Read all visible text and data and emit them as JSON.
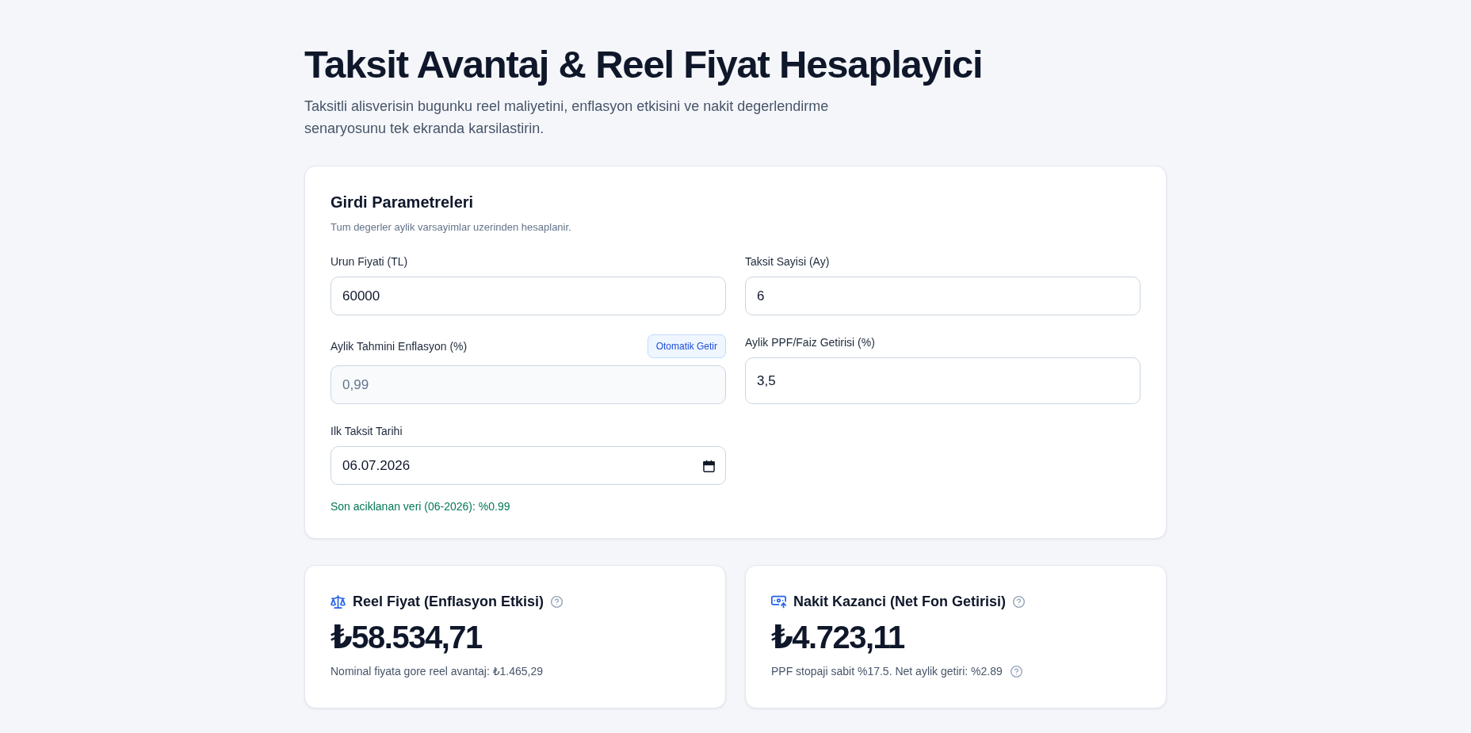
{
  "header": {
    "title": "Taksit Avantaj & Reel Fiyat Hesaplayici",
    "subtitle": "Taksitli alisverisin bugunku reel maliyetini, enflasyon etkisini ve nakit degerlendirme senaryosunu tek ekranda karsilastirin."
  },
  "form": {
    "title": "Girdi Parametreleri",
    "hint": "Tum degerler aylik varsayimlar uzerinden hesaplanir.",
    "fields": [
      {
        "label": "Urun Fiyati (TL)",
        "value": "60000",
        "kind": "text",
        "disabled": false
      },
      {
        "label": "Taksit Sayisi (Ay)",
        "value": "6",
        "kind": "text",
        "disabled": false
      },
      {
        "label": "Aylik Tahmini Enflasyon (%)",
        "value": "0,99",
        "kind": "text",
        "disabled": true,
        "button": "Otomatik Getir"
      },
      {
        "label": "Aylik PPF/Faiz Getirisi (%)",
        "value": "3,5",
        "kind": "text",
        "disabled": false
      },
      {
        "label": "Ilk Taksit Tarihi",
        "value": "06.07.2026",
        "kind": "date",
        "disabled": false
      }
    ],
    "note": "Son aciklanan veri (06-2026): %0.99"
  },
  "results": [
    {
      "kind": "inflation",
      "title": "Reel Fiyat (Enflasyon Etkisi)",
      "value": "₺58.534,71",
      "detail": "Nominal fiyata gore reel avantaj: ₺1.465,29",
      "detail_info": false
    },
    {
      "kind": "savings",
      "title": "Nakit Kazanci (Net Fon Getirisi)",
      "value": "₺4.723,11",
      "detail": "PPF stopaji sabit %17.5. Net aylik getiri: %2.89",
      "detail_info": true
    }
  ]
}
